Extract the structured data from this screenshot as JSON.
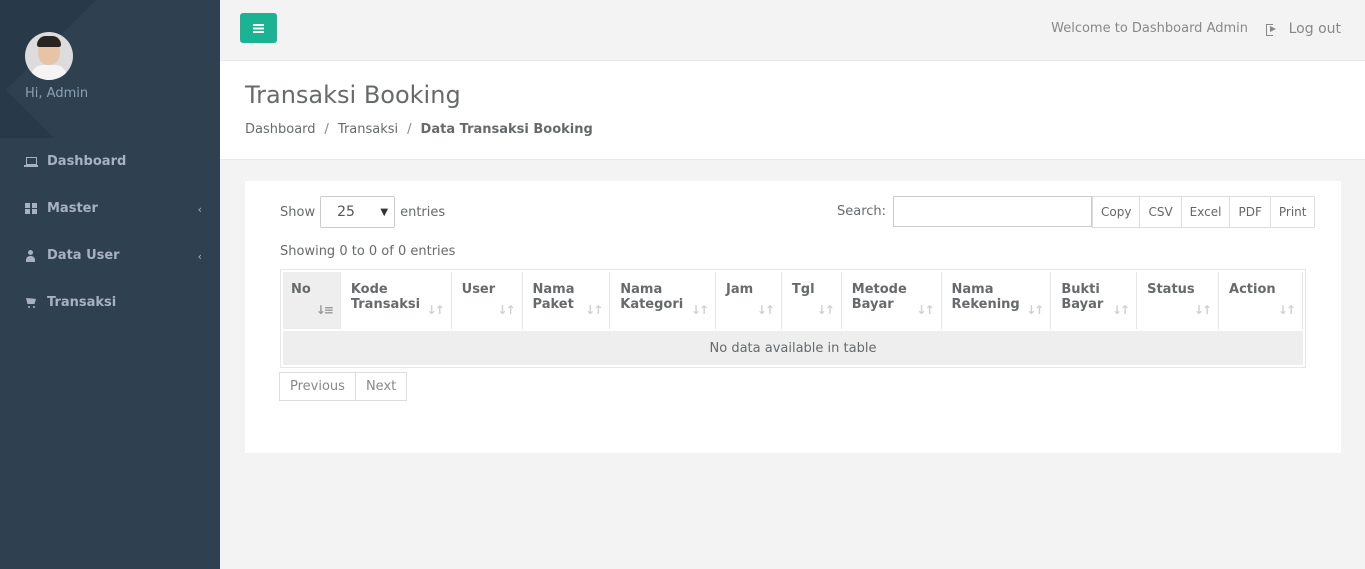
{
  "sidebar": {
    "greeting": "Hi, Admin",
    "items": [
      {
        "label": "Dashboard",
        "icon": "laptop-icon",
        "has_submenu": false
      },
      {
        "label": "Master",
        "icon": "th-large-icon",
        "has_submenu": true
      },
      {
        "label": "Data User",
        "icon": "user-icon",
        "has_submenu": true
      },
      {
        "label": "Transaksi",
        "icon": "cart-icon",
        "has_submenu": false
      }
    ],
    "chevron": "‹"
  },
  "topbar": {
    "welcome": "Welcome to Dashboard Admin",
    "logout": "Log out",
    "accent": "#1ab394"
  },
  "heading": {
    "title": "Transaksi Booking",
    "breadcrumb": [
      "Dashboard",
      "Transaksi",
      "Data Transaksi Booking"
    ],
    "separator": "/"
  },
  "table_controls": {
    "show_label": "Show",
    "entries_value": "25",
    "entries_label": "entries",
    "search_label": "Search:",
    "search_value": "",
    "export_buttons": [
      "Copy",
      "CSV",
      "Excel",
      "PDF",
      "Print"
    ],
    "info": "Showing 0 to 0 of 0 entries"
  },
  "table": {
    "columns": [
      {
        "l1": "No",
        "l2": ""
      },
      {
        "l1": "Kode",
        "l2": "Transaksi"
      },
      {
        "l1": "User",
        "l2": ""
      },
      {
        "l1": "Nama",
        "l2": "Paket"
      },
      {
        "l1": "Nama",
        "l2": "Kategori"
      },
      {
        "l1": "Jam",
        "l2": ""
      },
      {
        "l1": "Tgl",
        "l2": ""
      },
      {
        "l1": "Metode",
        "l2": "Bayar"
      },
      {
        "l1": "Nama",
        "l2": "Rekening"
      },
      {
        "l1": "Bukti",
        "l2": "Bayar"
      },
      {
        "l1": "Status",
        "l2": ""
      },
      {
        "l1": "Action",
        "l2": ""
      }
    ],
    "empty_message": "No data available in table"
  },
  "pagination": {
    "previous": "Previous",
    "next": "Next"
  }
}
